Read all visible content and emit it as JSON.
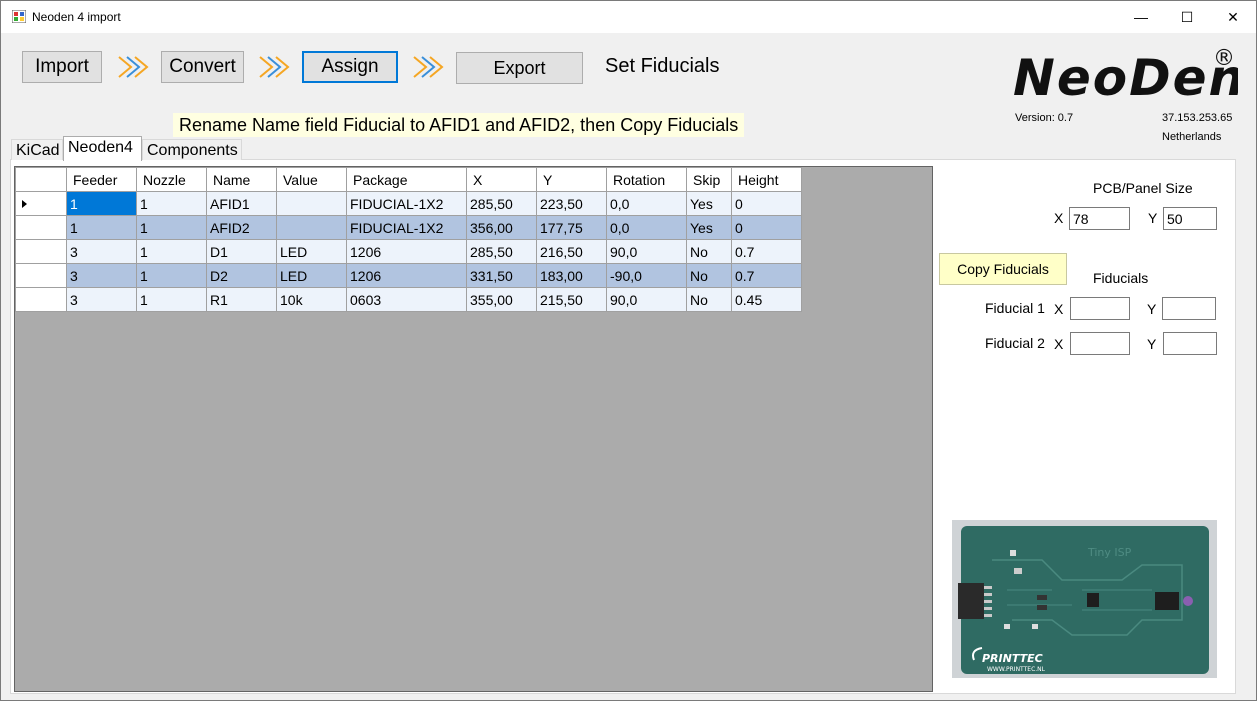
{
  "window": {
    "title": "Neoden 4 import",
    "minimize": "—",
    "maximize": "☐",
    "close": "✕"
  },
  "wizard": {
    "import": "Import",
    "convert": "Convert",
    "assign": "Assign",
    "export": "Export",
    "step_title": "Set Fiducials"
  },
  "instruction": "Rename Name field  Fiducial to AFID1 and AFID2, then Copy Fiducials",
  "brand": {
    "logo": "NeoDen",
    "registered": "®",
    "version": "Version: 0.7",
    "ip": "37.153.253.65",
    "country": "Netherlands"
  },
  "tabs": [
    "KiCad",
    "Neoden4",
    "Components"
  ],
  "table": {
    "columns": [
      "Feeder",
      "Nozzle",
      "Name",
      "Value",
      "Package",
      "X",
      "Y",
      "Rotation",
      "Skip",
      "Height"
    ],
    "rows": [
      [
        "1",
        "1",
        "AFID1",
        "",
        "FIDUCIAL-1X2",
        "285,50",
        "223,50",
        "0,0",
        "Yes",
        "0"
      ],
      [
        "1",
        "1",
        "AFID2",
        "",
        "FIDUCIAL-1X2",
        "356,00",
        "177,75",
        "0,0",
        "Yes",
        "0"
      ],
      [
        "3",
        "1",
        "D1",
        "LED",
        "1206",
        "285,50",
        "216,50",
        "90,0",
        "No",
        "0.7"
      ],
      [
        "3",
        "1",
        "D2",
        "LED",
        "1206",
        "331,50",
        "183,00",
        "-90,0",
        "No",
        "0.7"
      ],
      [
        "3",
        "1",
        "R1",
        "10k",
        "0603",
        "355,00",
        "215,50",
        "90,0",
        "No",
        "0.45"
      ]
    ]
  },
  "panel": {
    "size_label": "PCB/Panel Size",
    "x_label": "X",
    "y_label": "Y",
    "size_x": "78",
    "size_y": "50",
    "copy_button": "Copy Fiducials",
    "fiducials_label": "Fiducials",
    "fiducial1_label": "Fiducial 1",
    "fiducial2_label": "Fiducial 2",
    "f1_x": "",
    "f1_y": "",
    "f2_x": "",
    "f2_y": ""
  },
  "pcb_image": {
    "board_text": "Tiny ISP",
    "brand_text": "PRINTTEC",
    "url_text": "WWW.PRINTTEC.NL"
  },
  "colors": {
    "accent": "#0078d7",
    "row_alt": "#b1c4e0",
    "row_light": "#edf3fb",
    "grid_bg": "#ababab",
    "highlight": "#ffffe1",
    "arrow_orange": "#f5a623",
    "arrow_blue": "#3a8fd9",
    "pcb_green": "#2f6b63"
  }
}
